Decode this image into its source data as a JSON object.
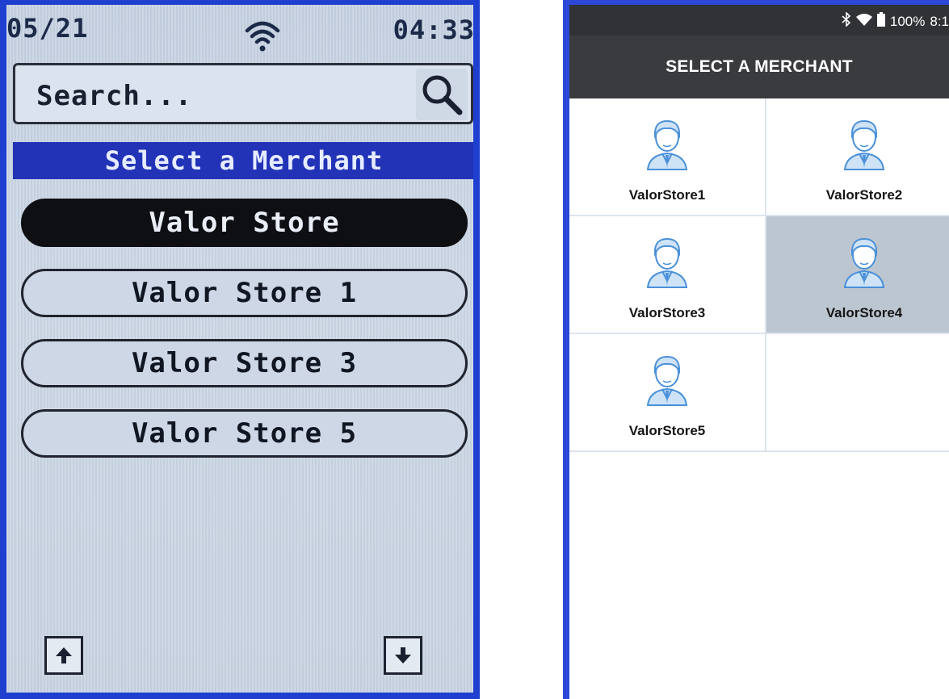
{
  "terminal": {
    "status": {
      "date": "05/21",
      "time": "04:33",
      "wifi_icon": "wifi-icon"
    },
    "search": {
      "placeholder": "Search...",
      "icon": "search-icon"
    },
    "header": "Select a Merchant",
    "merchants": [
      {
        "label": "Valor Store",
        "selected": true
      },
      {
        "label": "Valor Store 1",
        "selected": false
      },
      {
        "label": "Valor Store 3",
        "selected": false
      },
      {
        "label": "Valor Store 5",
        "selected": false
      }
    ],
    "nav": {
      "up_icon": "arrow-up-icon",
      "down_icon": "arrow-down-icon"
    },
    "colors": {
      "frame": "#1f3fd0",
      "header_bg": "#2233b8",
      "selected_bg": "#0e0f13"
    }
  },
  "android": {
    "status": {
      "bluetooth_icon": "bluetooth-icon",
      "wifi_icon": "wifi-icon",
      "battery_icon": "battery-icon",
      "battery": "100%",
      "time": "8:1"
    },
    "title": "SELECT A MERCHANT",
    "merchants": [
      {
        "label": "ValorStore1",
        "icon": "user-avatar-icon",
        "selected": false
      },
      {
        "label": "ValorStore2",
        "icon": "user-avatar-icon",
        "selected": false
      },
      {
        "label": "ValorStore3",
        "icon": "user-avatar-icon",
        "selected": false
      },
      {
        "label": "ValorStore4",
        "icon": "user-avatar-icon",
        "selected": true
      },
      {
        "label": "ValorStore5",
        "icon": "user-avatar-icon",
        "selected": false
      }
    ],
    "colors": {
      "app_bar": "#3a3b3e",
      "status_bar": "#303236",
      "selected_tile": "#bcc6d0",
      "icon": "#4a90d9"
    }
  }
}
